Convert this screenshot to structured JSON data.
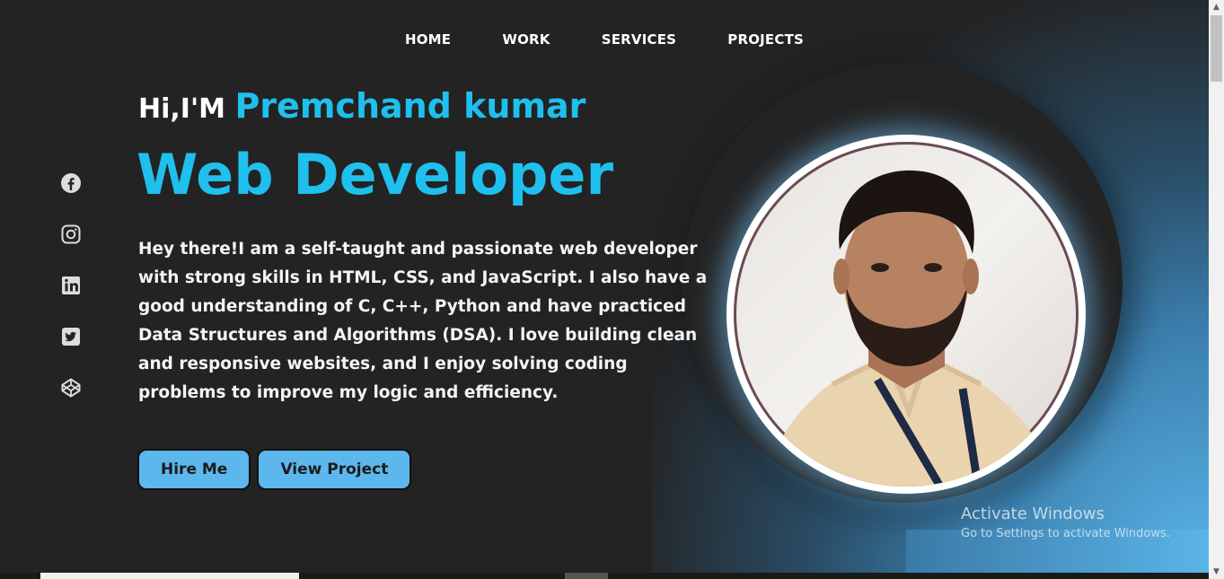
{
  "nav": {
    "items": [
      {
        "label": "HOME"
      },
      {
        "label": "WORK"
      },
      {
        "label": "SERVICES"
      },
      {
        "label": "PROJECTS"
      }
    ]
  },
  "hero": {
    "greeting": "Hi,I'M",
    "name": "Premchand kumar",
    "role": "Web Developer",
    "description": "Hey there!I am a self-taught and passionate web developer with strong skills in HTML, CSS, and JavaScript. I also have a good understanding of C, C++, Python and have practiced Data Structures and Algorithms (DSA). I love building clean and responsive websites, and I enjoy solving coding problems to improve my logic and efficiency.",
    "buttons": {
      "hire": "Hire Me",
      "project": "View Project"
    }
  },
  "social": [
    "facebook-icon",
    "instagram-icon",
    "linkedin-icon",
    "twitter-icon",
    "codepen-icon"
  ],
  "watermark": {
    "title": "Activate Windows",
    "subtitle": "Go to Settings to activate Windows."
  },
  "colors": {
    "accent": "#1fc0ee",
    "button": "#5cb7ec",
    "background": "#232323"
  }
}
